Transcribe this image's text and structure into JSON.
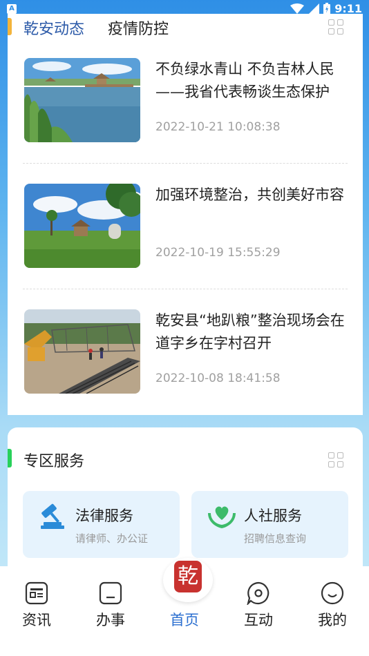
{
  "status_bar": {
    "badge": "A",
    "time": "9:11"
  },
  "news": {
    "tabs": [
      {
        "label": "乾安动态",
        "active": true
      },
      {
        "label": "疫情防控",
        "active": false
      }
    ],
    "accent_color": "#f3b43b",
    "items": [
      {
        "title": "不负绿水青山 不负吉林人民——我省代表畅谈生态保护",
        "time": "2022-10-21 10:08:38",
        "image": "lake-scenery"
      },
      {
        "title": "加强环境整治，共创美好市容",
        "time": "2022-10-19 15:55:29",
        "image": "park-scenery"
      },
      {
        "title": "乾安县“地趴粮”整治现场会在道字乡在字村召开",
        "time": "2022-10-08 18:41:58",
        "image": "construction-site"
      }
    ]
  },
  "services": {
    "title": "专区服务",
    "accent_color": "#28d15a",
    "tiles": [
      {
        "name": "法律服务",
        "sub": "请律师、办公证",
        "icon": "gavel-icon"
      },
      {
        "name": "人社服务",
        "sub": "招聘信息查询",
        "icon": "heart-hands-icon"
      }
    ]
  },
  "bottom_nav": {
    "items": [
      {
        "label": "资讯",
        "icon": "news-icon",
        "active": false
      },
      {
        "label": "办事",
        "icon": "task-icon",
        "active": false
      },
      {
        "label": "首页",
        "icon": "home-logo-icon",
        "active": true
      },
      {
        "label": "互动",
        "icon": "chat-icon",
        "active": false
      },
      {
        "label": "我的",
        "icon": "profile-icon",
        "active": false
      }
    ],
    "active_color": "#2b6fd0",
    "logo_glyph": "乾"
  }
}
